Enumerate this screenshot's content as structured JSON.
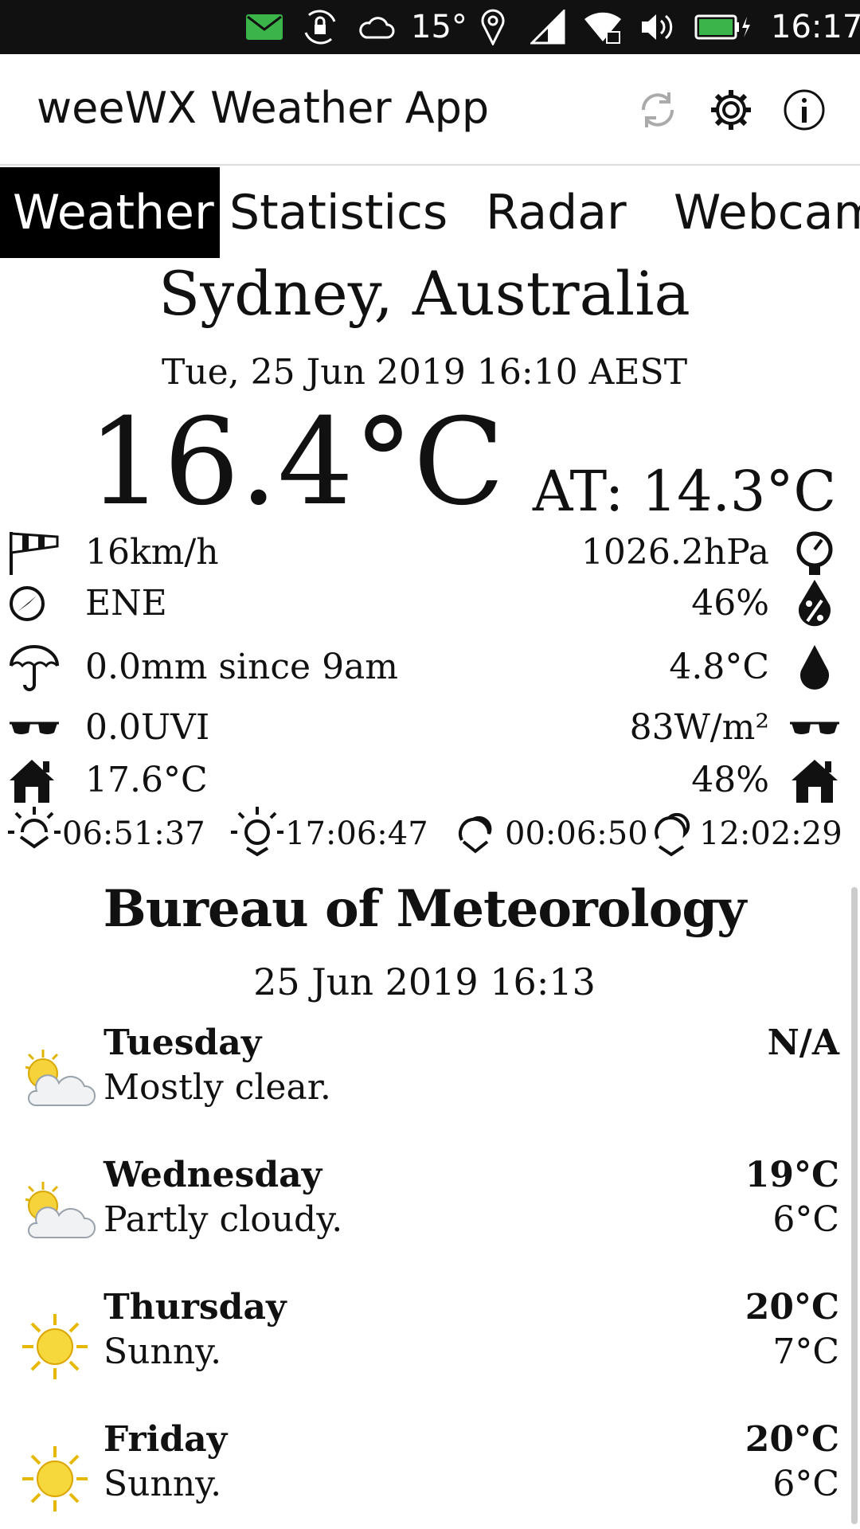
{
  "status_bar": {
    "temperature": "15°",
    "time": "16:17"
  },
  "app_bar": {
    "title": "weeWX Weather App",
    "icons": [
      "refresh-icon",
      "gear-icon",
      "info-icon"
    ]
  },
  "tabs": [
    {
      "label": "Weather",
      "active": true
    },
    {
      "label": "Statistics",
      "active": false
    },
    {
      "label": "Radar",
      "active": false
    },
    {
      "label": "Webcam",
      "active": false
    }
  ],
  "current": {
    "location": "Sydney, Australia",
    "datetime": "Tue, 25 Jun 2019 16:10 AEST",
    "temperature": "16.4°C",
    "apparent": "AT: 14.3°C",
    "wind_speed": "16km/h",
    "wind_direction": "ENE",
    "rain": "0.0mm since 9am",
    "uv": "0.0UVI",
    "indoor_temp": "17.6°C",
    "pressure": "1026.2hPa",
    "humidity": "46%",
    "dewpoint": "4.8°C",
    "solar": "83W/m²",
    "indoor_humidity": "48%"
  },
  "sun_moon": {
    "sunrise": "06:51:37",
    "sunset": "17:06:47",
    "moonrise": "00:06:50",
    "moonset": "12:02:29"
  },
  "forecast": {
    "source": "Bureau of Meteorology",
    "issued": "25 Jun 2019 16:13",
    "days": [
      {
        "day": "Tuesday",
        "desc": "Mostly clear.",
        "high": "N/A",
        "low": "",
        "icon": "partly-cloudy-icon"
      },
      {
        "day": "Wednesday",
        "desc": "Partly cloudy.",
        "high": "19°C",
        "low": "6°C",
        "icon": "partly-cloudy-icon"
      },
      {
        "day": "Thursday",
        "desc": "Sunny.",
        "high": "20°C",
        "low": "7°C",
        "icon": "sunny-icon"
      },
      {
        "day": "Friday",
        "desc": "Sunny.",
        "high": "20°C",
        "low": "6°C",
        "icon": "sunny-icon"
      }
    ]
  }
}
